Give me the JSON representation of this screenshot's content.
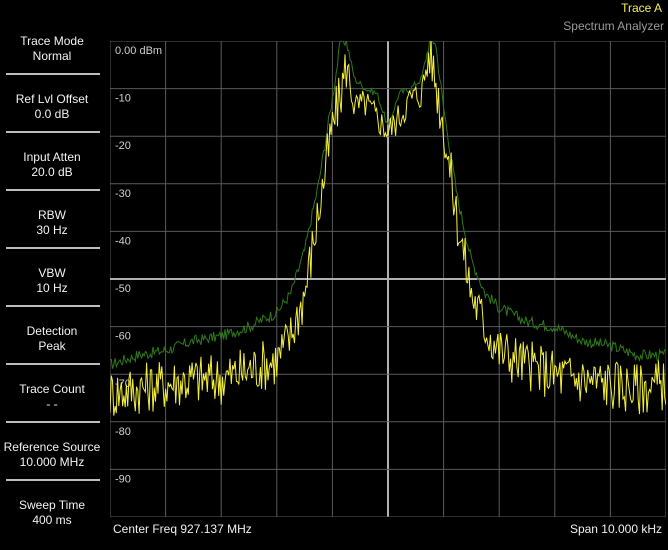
{
  "header": {
    "trace_title": "Trace A",
    "mode_title": "Spectrum Analyzer"
  },
  "softkeys": [
    {
      "label": "Trace Mode",
      "value": "Normal"
    },
    {
      "label": "Ref Lvl Offset",
      "value": "0.0 dB"
    },
    {
      "label": "Input Atten",
      "value": "20.0 dB"
    },
    {
      "label": "RBW",
      "value": "30 Hz"
    },
    {
      "label": "VBW",
      "value": "10 Hz"
    },
    {
      "label": "Detection",
      "value": "Peak"
    },
    {
      "label": "Trace Count",
      "value": "- -"
    },
    {
      "label": "Reference Source",
      "value": "10.000 MHz"
    },
    {
      "label": "Sweep Time",
      "value": "400 ms"
    }
  ],
  "footer": {
    "center_freq": "Center Freq 927.137 MHz",
    "span": "Span 10.000 kHz"
  },
  "colors": {
    "trace_live": "#f4ef3a",
    "trace_max": "#2e7a18",
    "grid": "#5a5a5a",
    "grid_center": "#b0b0b0"
  },
  "chart_data": {
    "type": "line",
    "ylabels": [
      "0.00 dBm",
      "-10",
      "-20",
      "-30",
      "-40",
      "-50",
      "-60",
      "-70",
      "-80",
      "-90"
    ],
    "ylim": [
      -100,
      0
    ],
    "xlim": [
      -5,
      5
    ],
    "x_unit": "kHz",
    "grid": true,
    "series": [
      {
        "color": "#2e7a18",
        "x": [
          -5,
          -4.5,
          -4,
          -3.5,
          -3,
          -2.5,
          -2,
          -1.75,
          -1.5,
          -1.25,
          -1,
          -0.85,
          -0.75,
          -0.6,
          -0.4,
          -0.2,
          0,
          0.2,
          0.4,
          0.6,
          0.75,
          0.85,
          1,
          1.25,
          1.5,
          1.75,
          2,
          2.5,
          3,
          3.5,
          4,
          4.5,
          5
        ],
        "y": [
          -68,
          -66,
          -65,
          -63,
          -62,
          -60,
          -57,
          -53,
          -44,
          -30,
          -12,
          0,
          0,
          -8,
          -10,
          -11,
          -18,
          -11,
          -10,
          -8,
          0,
          0,
          -14,
          -33,
          -46,
          -53,
          -56,
          -59,
          -60,
          -63,
          -64,
          -66,
          -66
        ]
      },
      {
        "color": "#f4ef3a",
        "x": [
          -5,
          -4.5,
          -4,
          -3.5,
          -3,
          -2.5,
          -2,
          -1.75,
          -1.5,
          -1.25,
          -1,
          -0.85,
          -0.75,
          -0.6,
          -0.4,
          -0.2,
          0,
          0.2,
          0.4,
          0.6,
          0.75,
          0.85,
          1,
          1.25,
          1.5,
          1.75,
          2,
          2.5,
          3,
          3.5,
          4,
          4.5,
          5
        ],
        "y": [
          -74,
          -73,
          -72,
          -71,
          -71,
          -69,
          -67,
          -62,
          -53,
          -36,
          -18,
          -11,
          -5,
          -14,
          -13,
          -16,
          -19,
          -16,
          -12,
          -11,
          -2,
          -8,
          -18,
          -38,
          -53,
          -60,
          -65,
          -68,
          -70,
          -71,
          -72,
          -73,
          -72
        ]
      }
    ]
  }
}
